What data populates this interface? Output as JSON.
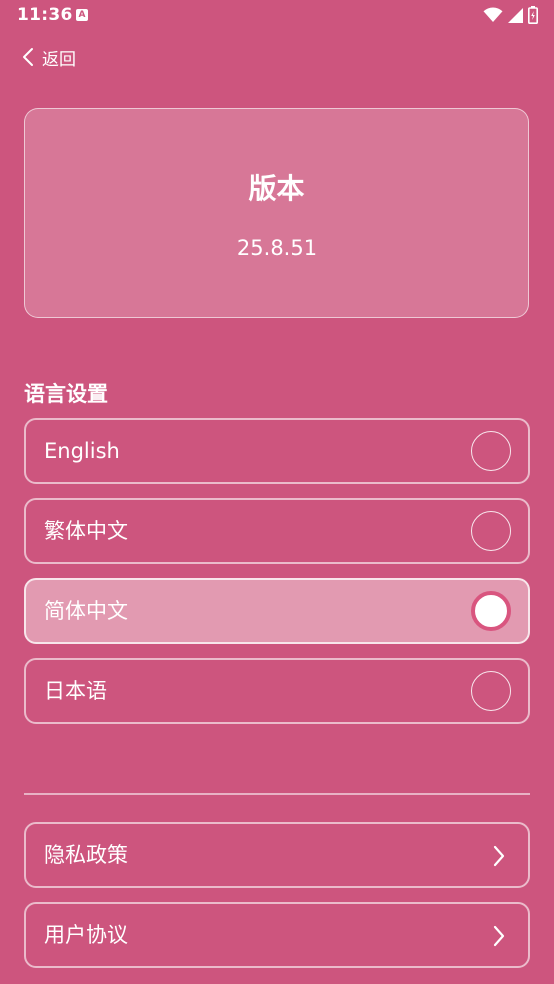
{
  "status_bar": {
    "time": "11:36",
    "notification_icon": "a-badge-icon",
    "icons": [
      "wifi-icon",
      "signal-icon",
      "battery-icon"
    ]
  },
  "nav": {
    "back_label": "返回",
    "back_icon": "chevron-left-icon"
  },
  "version_card": {
    "title": "版本",
    "version": "25.8.51"
  },
  "language": {
    "section_title": "语言设置",
    "options": [
      {
        "label": "English",
        "selected": false
      },
      {
        "label": "繁体中文",
        "selected": false
      },
      {
        "label": "简体中文",
        "selected": true
      },
      {
        "label": "日本语",
        "selected": false
      }
    ]
  },
  "links": [
    {
      "label": "隐私政策",
      "icon": "chevron-right-icon"
    },
    {
      "label": "用户协议",
      "icon": "chevron-right-icon"
    }
  ],
  "colors": {
    "background": "#cd557e",
    "selected_option": "#e29ab1",
    "radio_ring": "#d9557f",
    "text": "#ffffff"
  }
}
